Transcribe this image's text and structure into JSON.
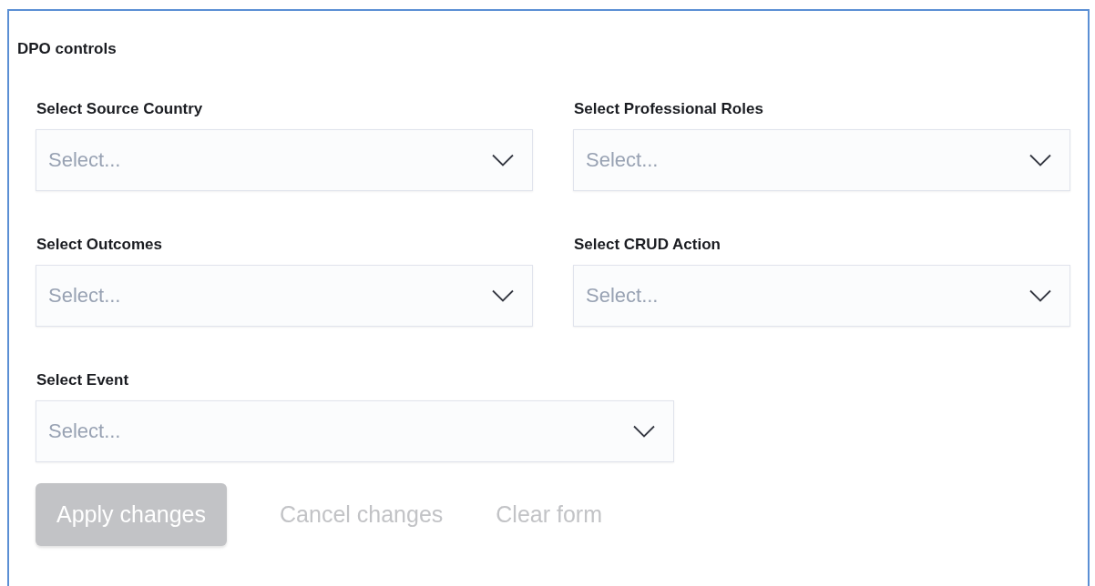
{
  "panel": {
    "title": "DPO controls"
  },
  "fields": [
    {
      "label": "Select Source Country",
      "placeholder": "Select..."
    },
    {
      "label": "Select Professional Roles",
      "placeholder": "Select..."
    },
    {
      "label": "Select Outcomes",
      "placeholder": "Select..."
    },
    {
      "label": "Select CRUD Action",
      "placeholder": "Select..."
    },
    {
      "label": "Select Event",
      "placeholder": "Select..."
    }
  ],
  "buttons": [
    {
      "label": "Apply changes",
      "kind": "filled",
      "disabled": true
    },
    {
      "label": "Cancel changes",
      "kind": "text",
      "disabled": true
    },
    {
      "label": "Clear form",
      "kind": "text",
      "disabled": true
    }
  ]
}
